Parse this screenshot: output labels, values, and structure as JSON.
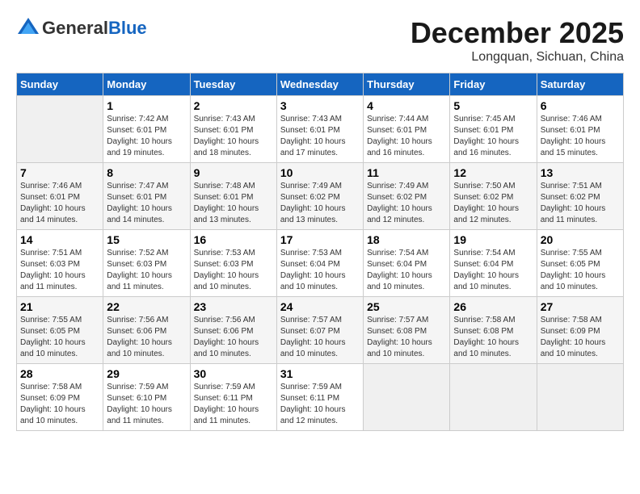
{
  "header": {
    "logo_general": "General",
    "logo_blue": "Blue",
    "month_year": "December 2025",
    "location": "Longquan, Sichuan, China"
  },
  "days_of_week": [
    "Sunday",
    "Monday",
    "Tuesday",
    "Wednesday",
    "Thursday",
    "Friday",
    "Saturday"
  ],
  "weeks": [
    [
      {
        "day": "",
        "sunrise": "",
        "sunset": "",
        "daylight": ""
      },
      {
        "day": "1",
        "sunrise": "7:42 AM",
        "sunset": "6:01 PM",
        "daylight": "10 hours and 19 minutes."
      },
      {
        "day": "2",
        "sunrise": "7:43 AM",
        "sunset": "6:01 PM",
        "daylight": "10 hours and 18 minutes."
      },
      {
        "day": "3",
        "sunrise": "7:43 AM",
        "sunset": "6:01 PM",
        "daylight": "10 hours and 17 minutes."
      },
      {
        "day": "4",
        "sunrise": "7:44 AM",
        "sunset": "6:01 PM",
        "daylight": "10 hours and 16 minutes."
      },
      {
        "day": "5",
        "sunrise": "7:45 AM",
        "sunset": "6:01 PM",
        "daylight": "10 hours and 16 minutes."
      },
      {
        "day": "6",
        "sunrise": "7:46 AM",
        "sunset": "6:01 PM",
        "daylight": "10 hours and 15 minutes."
      }
    ],
    [
      {
        "day": "7",
        "sunrise": "7:46 AM",
        "sunset": "6:01 PM",
        "daylight": "10 hours and 14 minutes."
      },
      {
        "day": "8",
        "sunrise": "7:47 AM",
        "sunset": "6:01 PM",
        "daylight": "10 hours and 14 minutes."
      },
      {
        "day": "9",
        "sunrise": "7:48 AM",
        "sunset": "6:01 PM",
        "daylight": "10 hours and 13 minutes."
      },
      {
        "day": "10",
        "sunrise": "7:49 AM",
        "sunset": "6:02 PM",
        "daylight": "10 hours and 13 minutes."
      },
      {
        "day": "11",
        "sunrise": "7:49 AM",
        "sunset": "6:02 PM",
        "daylight": "10 hours and 12 minutes."
      },
      {
        "day": "12",
        "sunrise": "7:50 AM",
        "sunset": "6:02 PM",
        "daylight": "10 hours and 12 minutes."
      },
      {
        "day": "13",
        "sunrise": "7:51 AM",
        "sunset": "6:02 PM",
        "daylight": "10 hours and 11 minutes."
      }
    ],
    [
      {
        "day": "14",
        "sunrise": "7:51 AM",
        "sunset": "6:03 PM",
        "daylight": "10 hours and 11 minutes."
      },
      {
        "day": "15",
        "sunrise": "7:52 AM",
        "sunset": "6:03 PM",
        "daylight": "10 hours and 11 minutes."
      },
      {
        "day": "16",
        "sunrise": "7:53 AM",
        "sunset": "6:03 PM",
        "daylight": "10 hours and 10 minutes."
      },
      {
        "day": "17",
        "sunrise": "7:53 AM",
        "sunset": "6:04 PM",
        "daylight": "10 hours and 10 minutes."
      },
      {
        "day": "18",
        "sunrise": "7:54 AM",
        "sunset": "6:04 PM",
        "daylight": "10 hours and 10 minutes."
      },
      {
        "day": "19",
        "sunrise": "7:54 AM",
        "sunset": "6:04 PM",
        "daylight": "10 hours and 10 minutes."
      },
      {
        "day": "20",
        "sunrise": "7:55 AM",
        "sunset": "6:05 PM",
        "daylight": "10 hours and 10 minutes."
      }
    ],
    [
      {
        "day": "21",
        "sunrise": "7:55 AM",
        "sunset": "6:05 PM",
        "daylight": "10 hours and 10 minutes."
      },
      {
        "day": "22",
        "sunrise": "7:56 AM",
        "sunset": "6:06 PM",
        "daylight": "10 hours and 10 minutes."
      },
      {
        "day": "23",
        "sunrise": "7:56 AM",
        "sunset": "6:06 PM",
        "daylight": "10 hours and 10 minutes."
      },
      {
        "day": "24",
        "sunrise": "7:57 AM",
        "sunset": "6:07 PM",
        "daylight": "10 hours and 10 minutes."
      },
      {
        "day": "25",
        "sunrise": "7:57 AM",
        "sunset": "6:08 PM",
        "daylight": "10 hours and 10 minutes."
      },
      {
        "day": "26",
        "sunrise": "7:58 AM",
        "sunset": "6:08 PM",
        "daylight": "10 hours and 10 minutes."
      },
      {
        "day": "27",
        "sunrise": "7:58 AM",
        "sunset": "6:09 PM",
        "daylight": "10 hours and 10 minutes."
      }
    ],
    [
      {
        "day": "28",
        "sunrise": "7:58 AM",
        "sunset": "6:09 PM",
        "daylight": "10 hours and 10 minutes."
      },
      {
        "day": "29",
        "sunrise": "7:59 AM",
        "sunset": "6:10 PM",
        "daylight": "10 hours and 11 minutes."
      },
      {
        "day": "30",
        "sunrise": "7:59 AM",
        "sunset": "6:11 PM",
        "daylight": "10 hours and 11 minutes."
      },
      {
        "day": "31",
        "sunrise": "7:59 AM",
        "sunset": "6:11 PM",
        "daylight": "10 hours and 12 minutes."
      },
      {
        "day": "",
        "sunrise": "",
        "sunset": "",
        "daylight": ""
      },
      {
        "day": "",
        "sunrise": "",
        "sunset": "",
        "daylight": ""
      },
      {
        "day": "",
        "sunrise": "",
        "sunset": "",
        "daylight": ""
      }
    ]
  ]
}
